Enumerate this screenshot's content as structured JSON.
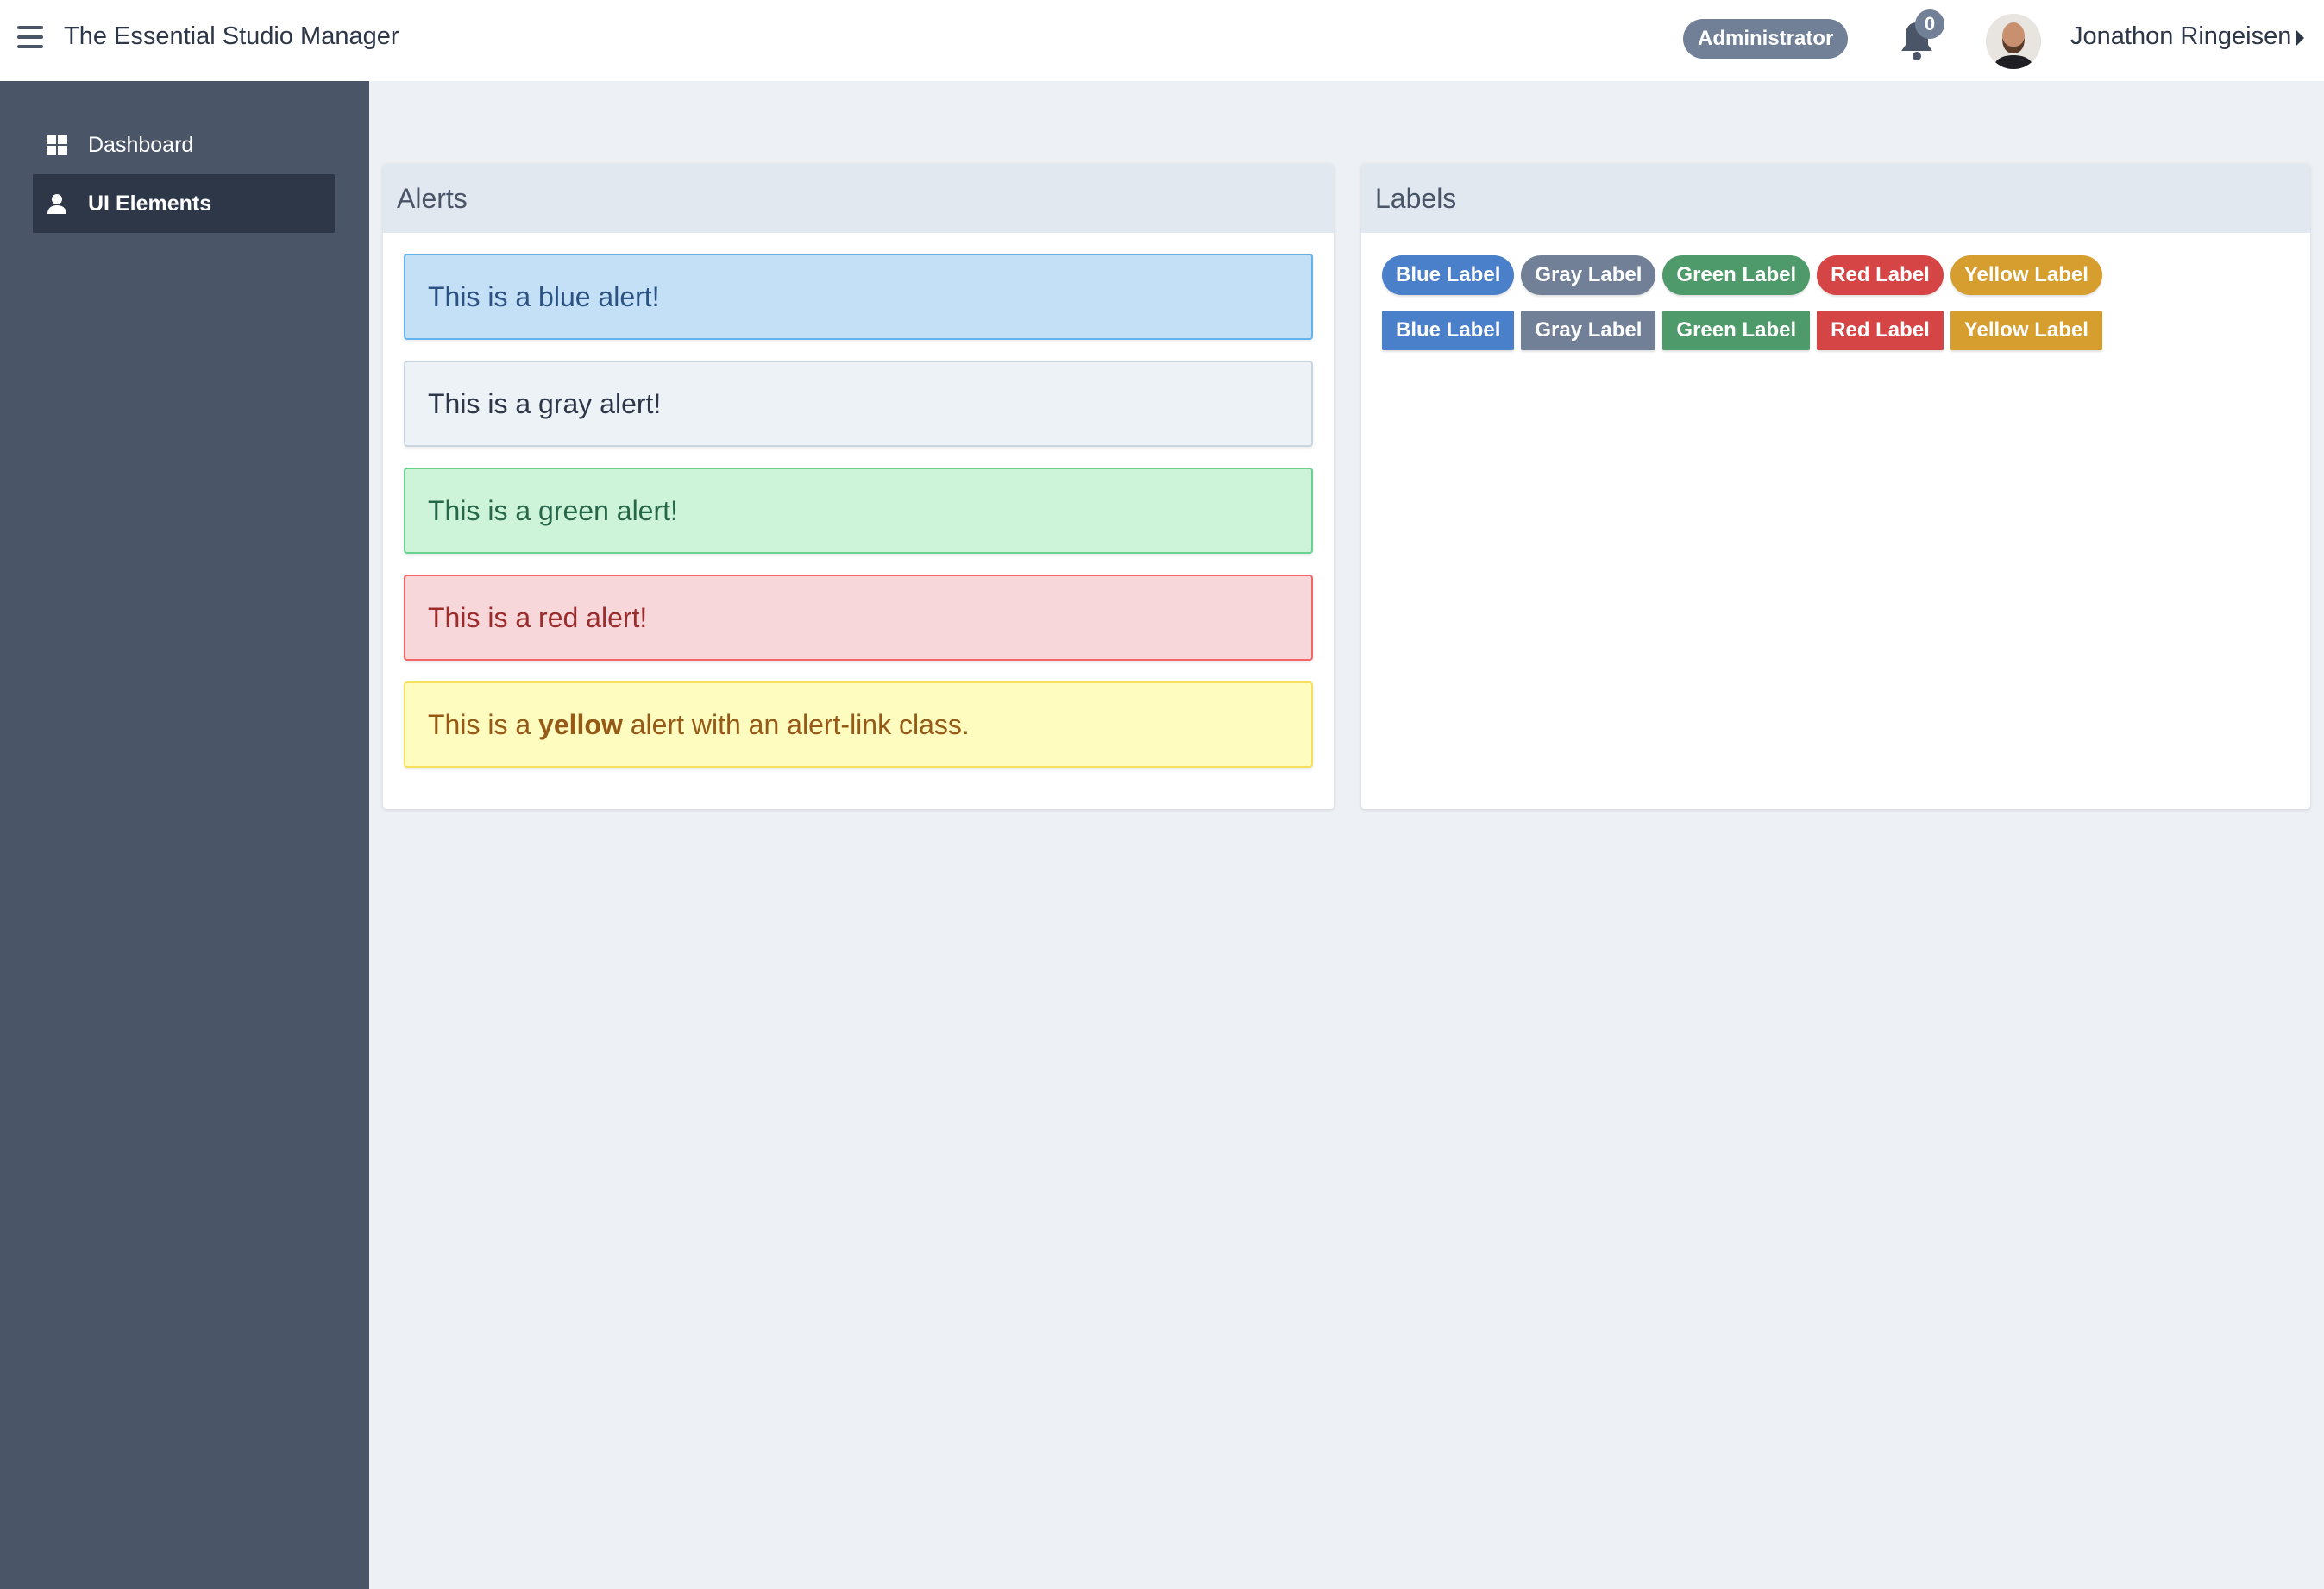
{
  "header": {
    "app_title": "The Essential Studio Manager",
    "role_badge": "Administrator",
    "notification_count": "0",
    "user_name": "Jonathon Ringeisen"
  },
  "sidebar": {
    "items": [
      {
        "label": "Dashboard",
        "icon": "dashboard-icon",
        "active": false
      },
      {
        "label": "UI Elements",
        "icon": "user-icon",
        "active": true
      }
    ]
  },
  "alerts_panel": {
    "title": "Alerts",
    "blue": "This is a blue alert!",
    "gray": "This is a gray alert!",
    "green": "This is a green alert!",
    "red": "This is a red alert!",
    "yellow_prefix": "This is a ",
    "yellow_link": "yellow",
    "yellow_suffix": " alert with an alert-link class."
  },
  "labels_panel": {
    "title": "Labels",
    "pill_labels": [
      "Blue Label",
      "Gray Label",
      "Green Label",
      "Red Label",
      "Yellow Label"
    ],
    "square_labels": [
      "Blue Label",
      "Gray Label",
      "Green Label",
      "Red Label",
      "Yellow Label"
    ]
  },
  "colors": {
    "sidebar": "#4a5568",
    "sidebar_active": "#2d3748",
    "background": "#edf0f4",
    "blue": "#4a7fca",
    "gray": "#718096",
    "green": "#4f9a6a",
    "red": "#d64545",
    "yellow": "#d69e2e"
  }
}
